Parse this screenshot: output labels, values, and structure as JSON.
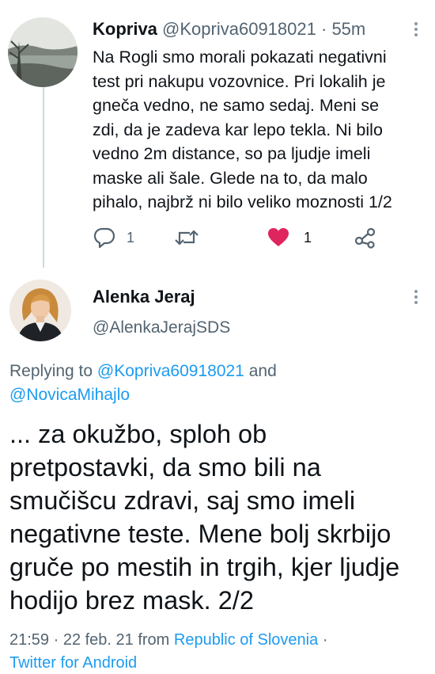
{
  "tweet1": {
    "author_name": "Kopriva",
    "author_handle": "@Kopriva60918021",
    "separator": "·",
    "time": "55m",
    "text_lines": [
      "Na Rogli smo morali pokazati negativni",
      "test pri nakupu vozovnice. Pri lokalih je",
      "gneča vedno, ne samo sedaj. Meni se",
      "zdi, da je zadeva kar lepo tekla. Ni bilo",
      "vedno 2m distance, so pa ljudje imeli",
      "maske ali šale. Glede na to, da malo",
      "pihalo, najbrž ni bilo veliko moznosti 1/2"
    ],
    "reply_count": "1",
    "like_count": "1",
    "liked": true,
    "like_color": "#e0245e"
  },
  "tweet2": {
    "author_name": "Alenka Jeraj",
    "author_handle": "@AlenkaJerajSDS",
    "replying_prefix": "Replying to",
    "replying_mention1": "@Kopriva60918021",
    "replying_and": "and",
    "replying_mention2": "@NovicaMihajlo",
    "text_lines": [
      "... za okužbo, sploh ob",
      "pretpostavki, da smo bili na",
      "smučišcu zdravi, saj smo imeli",
      "negativne teste. Mene bolj skrbijo",
      "gruče po mestih in trgih, kjer ljudje",
      "hodijo brez mask. 2/2"
    ],
    "timestamp": "21:59 · 22 feb. 21 from",
    "location": "Republic of Slovenia",
    "meta_sep": "·",
    "source": "Twitter for Android"
  },
  "icons": {
    "reply": "speech-bubble-icon",
    "retweet": "retweet-arrows-icon",
    "like": "heart-icon",
    "share": "share-nodes-icon",
    "more": "vertical-dots-icon"
  },
  "colors": {
    "link": "#1d9bf0",
    "secondary_text": "#536471",
    "primary_text": "#0f1419"
  }
}
